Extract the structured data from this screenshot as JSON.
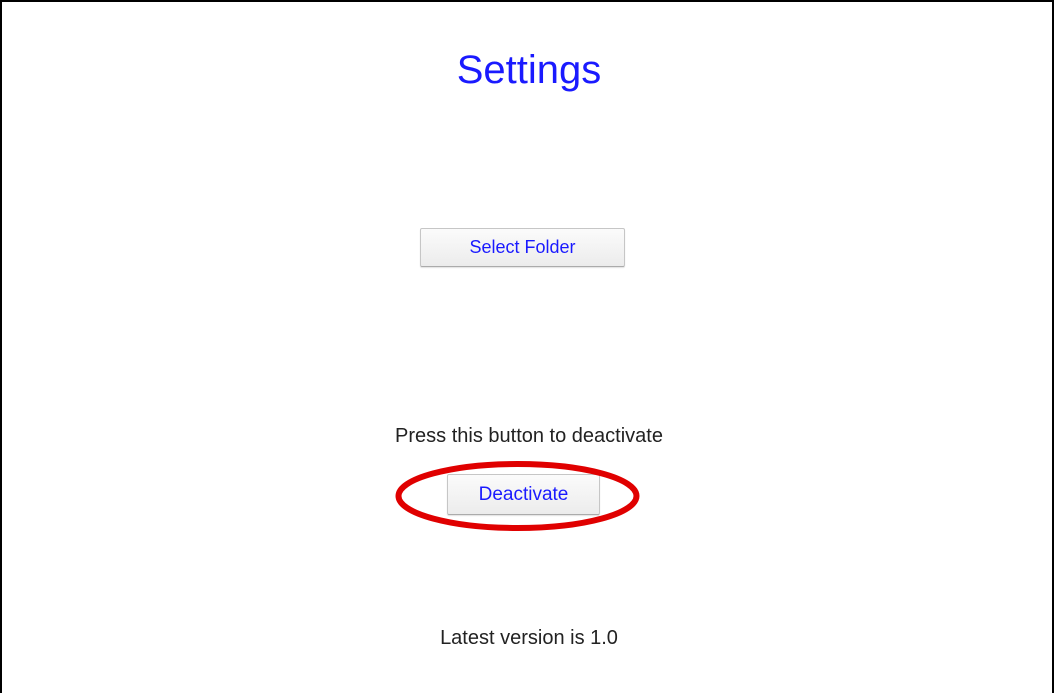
{
  "page": {
    "title": "Settings",
    "accent_color": "#1a1aff",
    "highlight_color": "#e00000"
  },
  "buttons": {
    "select_folder_label": "Select Folder",
    "deactivate_label": "Deactivate"
  },
  "deactivate_section": {
    "prompt": "Press this button to deactivate"
  },
  "footer": {
    "version_text": "Latest version is 1.0"
  }
}
